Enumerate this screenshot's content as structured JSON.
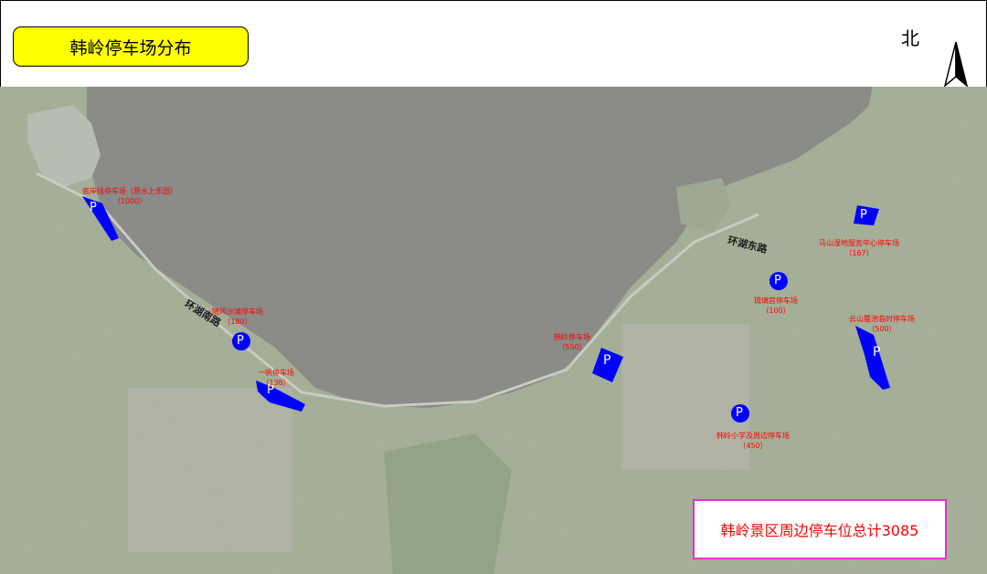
{
  "header": {
    "title": "韩岭停车场分布",
    "north": "北"
  },
  "roads": [
    "环湖南路",
    "环湖东路"
  ],
  "parking_lots": [
    {
      "name": "南岸线停车场（原水上乐园）",
      "capacity": "（1000）"
    },
    {
      "name": "随风沙滩停车场",
      "capacity": "（180）"
    },
    {
      "name": "一帆停车场",
      "capacity": "（138）"
    },
    {
      "name": "韩岭停车场",
      "capacity": "（550）"
    },
    {
      "name": "琉璃宫停车场",
      "capacity": "（100）"
    },
    {
      "name": "马山湿地服务中心停车场",
      "capacity": "（167）"
    },
    {
      "name": "云山麓池临时停车场",
      "capacity": "（500）"
    },
    {
      "name": "韩岭小学及周边停车场",
      "capacity": "（450）"
    }
  ],
  "parking_symbol": "P",
  "total": "韩岭景区周边停车位总计3085",
  "colors": {
    "title_bg": "#ffff00",
    "label_red": "#ff0000",
    "parking_blue": "#0000ff",
    "total_border": "#e030d0",
    "lake": "#8a8a86",
    "land": "#a9b29c"
  }
}
